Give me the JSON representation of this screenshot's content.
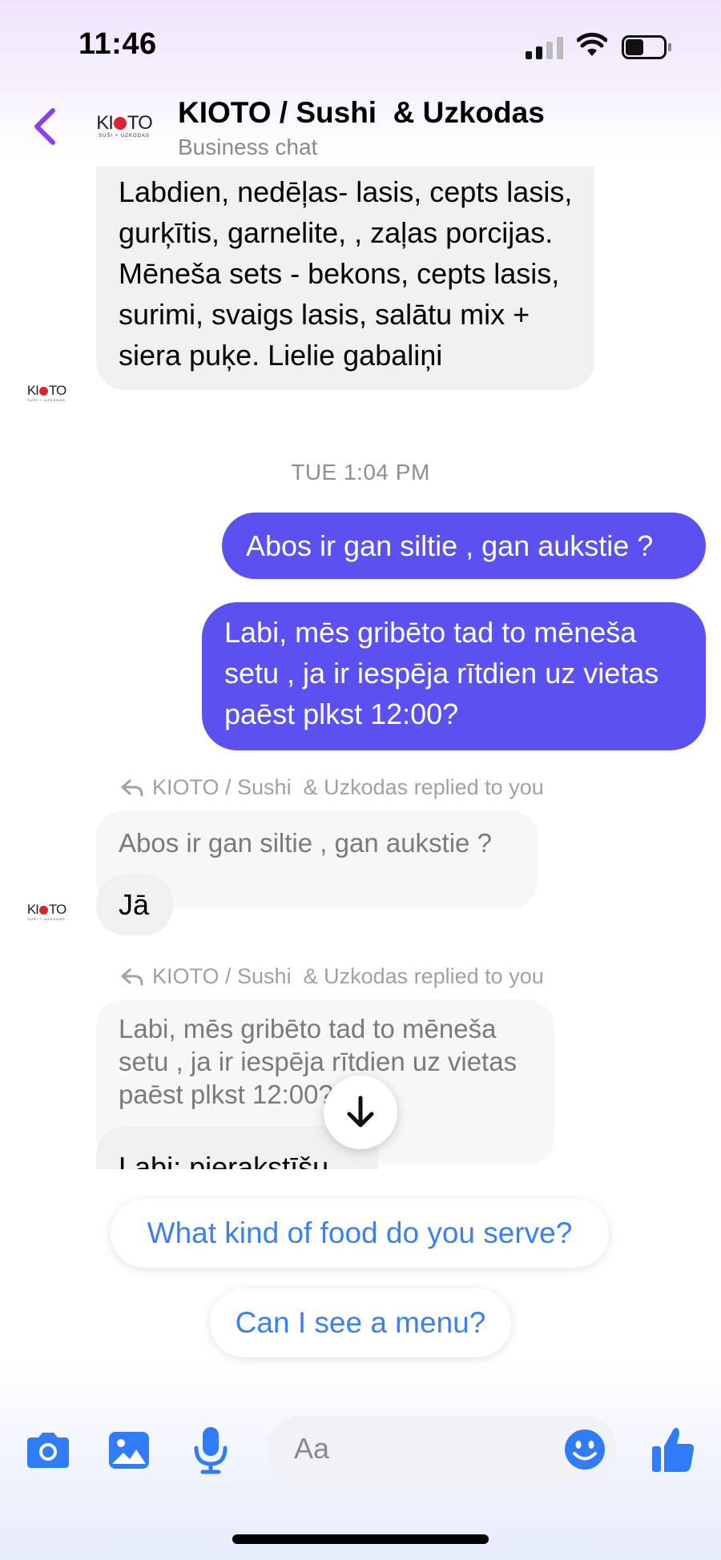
{
  "status_bar": {
    "time": "11:46",
    "signal_icon": "cellular-signal-icon",
    "wifi_icon": "wifi-icon",
    "battery_icon": "battery-icon"
  },
  "header": {
    "back_icon": "chevron-left-icon",
    "logo_text": "KIOTO",
    "logo_subtext": "SUŠI + UZKODAS",
    "title": "KIOTO / Sushi  & Uzkodas",
    "subtitle": "Business chat"
  },
  "messages": {
    "incoming_1": "Labdien, nedēļas- lasis, cepts lasis, gurķītis, garnelite, , zaļas porcijas. Mēneša sets - bekons, cepts lasis, surimi, svaigs lasis, salātu mix + siera puķe. Lielie gabaliņi",
    "timestamp": "TUE 1:04 PM",
    "outgoing_1": "Abos ir gan siltie , gan aukstie ?",
    "outgoing_2": "Labi, mēs gribēto tad to mēneša setu , ja ir iespēja rītdien uz vietas paēst plkst 12:00?",
    "reply_label_1": "KIOTO / Sushi  & Uzkodas replied to you",
    "quoted_1": "Abos ir gan siltie , gan aukstie ?",
    "incoming_2": "Jā",
    "reply_label_2": "KIOTO / Sushi  & Uzkodas replied to you",
    "quoted_2": "Labi, mēs gribēto tad to mēneša setu , ja ir iespēja rītdien uz vietas paēst plkst 12:00?",
    "incoming_3": "Labi: pierakstīšu."
  },
  "suggestions": [
    "What kind of food do you serve?",
    "Can I see a menu?"
  ],
  "composer": {
    "placeholder": "Aa",
    "icons": [
      "camera-icon",
      "image-icon",
      "microphone-icon",
      "emoji-icon",
      "thumbs-up-icon"
    ]
  },
  "colors": {
    "accent": "#5b51f0",
    "link": "#3b7ff0",
    "back": "#8b3ff2",
    "icon_blue": "#2f7cf6",
    "brand_red": "#d9242e"
  }
}
